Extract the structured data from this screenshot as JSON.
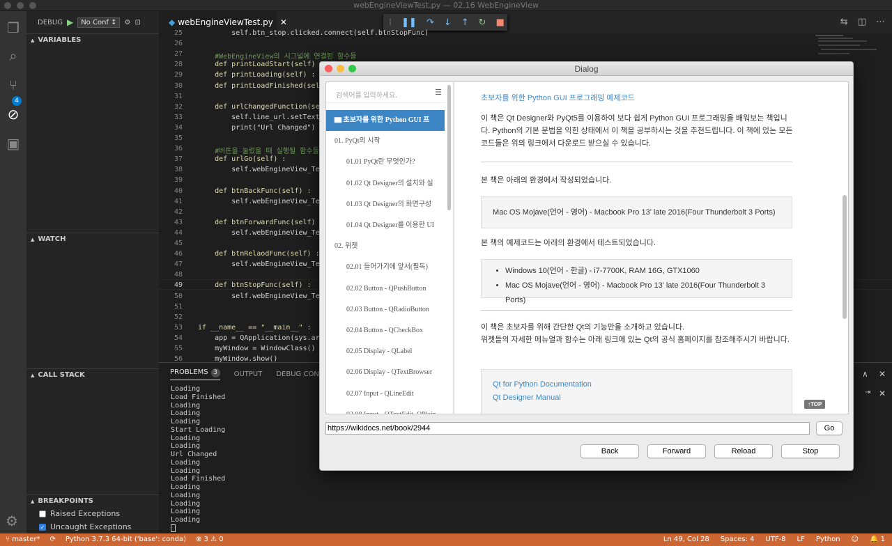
{
  "window": {
    "title": "webEngineViewTest.py — 02.16 WebEngineView"
  },
  "debug": {
    "label": "DEBUG",
    "config": "No Conf ↕"
  },
  "scm_badge": "4",
  "sidebar": {
    "variables": "VARIABLES",
    "watch": "WATCH",
    "call_stack": "CALL STACK",
    "breakpoints": "BREAKPOINTS",
    "bp_items": [
      {
        "label": "Raised Exceptions",
        "checked": false
      },
      {
        "label": "Uncaught Exceptions",
        "checked": true
      }
    ]
  },
  "editor": {
    "tab": "webEngineViewTest.py",
    "lines": [
      {
        "n": "25",
        "t": "        self.btn_stop.clicked.connect(self.btnStopFunc)"
      },
      {
        "n": "26",
        "t": ""
      },
      {
        "n": "27",
        "t": "    #WebEngineView의 시그널에 연결된 함수들"
      },
      {
        "n": "28",
        "t": "    def printLoadStart(self)"
      },
      {
        "n": "29",
        "t": "    def printLoading(self) :"
      },
      {
        "n": "30",
        "t": "    def printLoadFinished(self"
      },
      {
        "n": "31",
        "t": ""
      },
      {
        "n": "32",
        "t": "    def urlChangedFunction(se"
      },
      {
        "n": "33",
        "t": "        self.line_url.setText"
      },
      {
        "n": "34",
        "t": "        print(\"Url Changed\")"
      },
      {
        "n": "35",
        "t": ""
      },
      {
        "n": "36",
        "t": "    #버튼을 눌렀을 때 실행될 함수들"
      },
      {
        "n": "37",
        "t": "    def urlGo(self) :"
      },
      {
        "n": "38",
        "t": "        self.webEngineView_Te"
      },
      {
        "n": "39",
        "t": ""
      },
      {
        "n": "40",
        "t": "    def btnBackFunc(self) :"
      },
      {
        "n": "41",
        "t": "        self.webEngineView_Te"
      },
      {
        "n": "42",
        "t": ""
      },
      {
        "n": "43",
        "t": "    def btnForwardFunc(self)"
      },
      {
        "n": "44",
        "t": "        self.webEngineView_Te"
      },
      {
        "n": "45",
        "t": ""
      },
      {
        "n": "46",
        "t": "    def btnRelaodFunc(self) :"
      },
      {
        "n": "47",
        "t": "        self.webEngineView_Te"
      },
      {
        "n": "48",
        "t": ""
      },
      {
        "n": "49",
        "t": "    def btnStopFunc(self) :"
      },
      {
        "n": "50",
        "t": "        self.webEngineView_Te"
      },
      {
        "n": "51",
        "t": ""
      },
      {
        "n": "52",
        "t": ""
      },
      {
        "n": "53",
        "t": "if __name__ == \"__main__\" :"
      },
      {
        "n": "54",
        "t": "    app = QApplication(sys.ar"
      },
      {
        "n": "55",
        "t": "    myWindow = WindowClass()"
      },
      {
        "n": "56",
        "t": "    myWindow.show()"
      }
    ]
  },
  "panel": {
    "tabs": [
      "PROBLEMS",
      "OUTPUT",
      "DEBUG CONSO"
    ],
    "problems_count": "3",
    "terminal": [
      "Loading",
      "Load Finished",
      "Loading",
      "Loading",
      "Loading",
      "Start Loading",
      "Loading",
      "Loading",
      "Url Changed",
      "Loading",
      "Loading",
      "Load Finished",
      "Loading",
      "Loading",
      "Loading",
      "Loading",
      "Loading"
    ]
  },
  "statusbar": {
    "branch": "master*",
    "python": "Python 3.7.3 64-bit ('base': conda)",
    "errors": "⊗ 3 ⚠ 0",
    "position": "Ln 49, Col 28",
    "spaces": "Spaces: 4",
    "encoding": "UTF-8",
    "eol": "LF",
    "language": "Python",
    "bell": "1"
  },
  "dialog": {
    "title": "Dialog",
    "search_placeholder": "검색어를 입력하세요.",
    "toc": [
      {
        "label": "초보자를 위한 Python GUI 프",
        "level": 0,
        "active": true
      },
      {
        "label": "01. PyQt의 시작",
        "level": 0
      },
      {
        "label": "01.01 PyQt란 무엇인가?",
        "level": 1
      },
      {
        "label": "01.02 Qt Designer의 설치와 실",
        "level": 1
      },
      {
        "label": "01.03 Qt Designer의 화면구성",
        "level": 1
      },
      {
        "label": "01.04 Qt Designer를 이용한 UI",
        "level": 1
      },
      {
        "label": "02. 위젯",
        "level": 0
      },
      {
        "label": "02.01 들어가기에 앞서(필독)",
        "level": 1
      },
      {
        "label": "02.02 Button - QPushButton",
        "level": 1
      },
      {
        "label": "02.03 Button - QRadioButton",
        "level": 1
      },
      {
        "label": "02.04 Button - QCheckBox",
        "level": 1
      },
      {
        "label": "02.05 Display - QLabel",
        "level": 1
      },
      {
        "label": "02.06 Display - QTextBrowser",
        "level": 1
      },
      {
        "label": "02.07 Input - QLineEdit",
        "level": 1
      },
      {
        "label": "02.08 Input - QTextEdit, QPlain",
        "level": 1
      }
    ],
    "content": {
      "heading": "초보자를 위한 Python GUI 프로그래밍 예제코드",
      "intro": "이 책은 Qt Designer와 PyQt5를 이용하여 보다 쉽게 Python GUI 프로그래밍을 배워보는 책입니다. Python의 기본 문법을 익힌 상태에서 이 책을 공부하시는 것을 추천드립니다. 이 책에 있는 모든 코드들은 위의 링크에서 다운로드 받으실 수 있습니다.",
      "env_intro": "본 책은 아래의 환경에서 작성되었습니다.",
      "env_box": "Mac OS Mojave(언어 - 영어) - Macbook Pro 13' late 2016(Four Thunderbolt 3 Ports)",
      "test_intro": "본 책의 예제코드는 아래의 환경에서 테스트되었습니다.",
      "test_items": [
        "Windows 10(언어 - 한글) - i7-7700K, RAM 16G, GTX1060",
        "Mac OS Mojave(언어 - 영어) - Macbook Pro 13' late 2016(Four Thunderbolt 3 Ports)"
      ],
      "desc": "이 책은 초보자를 위해 간단한 Qt의 기능만을 소개하고 있습니다.\n위젯들의 자세한 메뉴얼과 함수는 아래 링크에 있는 Qt의 공식 홈페이지를 참조해주시기 바랍니다.",
      "links": [
        "Qt for Python Documentation",
        "Qt Designer Manual"
      ],
      "top": "↑TOP"
    },
    "url": "https://wikidocs.net/book/2944",
    "go": "Go",
    "back": "Back",
    "forward": "Forward",
    "reload": "Reload",
    "stop": "Stop"
  },
  "colors": {
    "statusbar": "#cc6633",
    "accent": "#3d86c6",
    "badge": "#007acc"
  }
}
